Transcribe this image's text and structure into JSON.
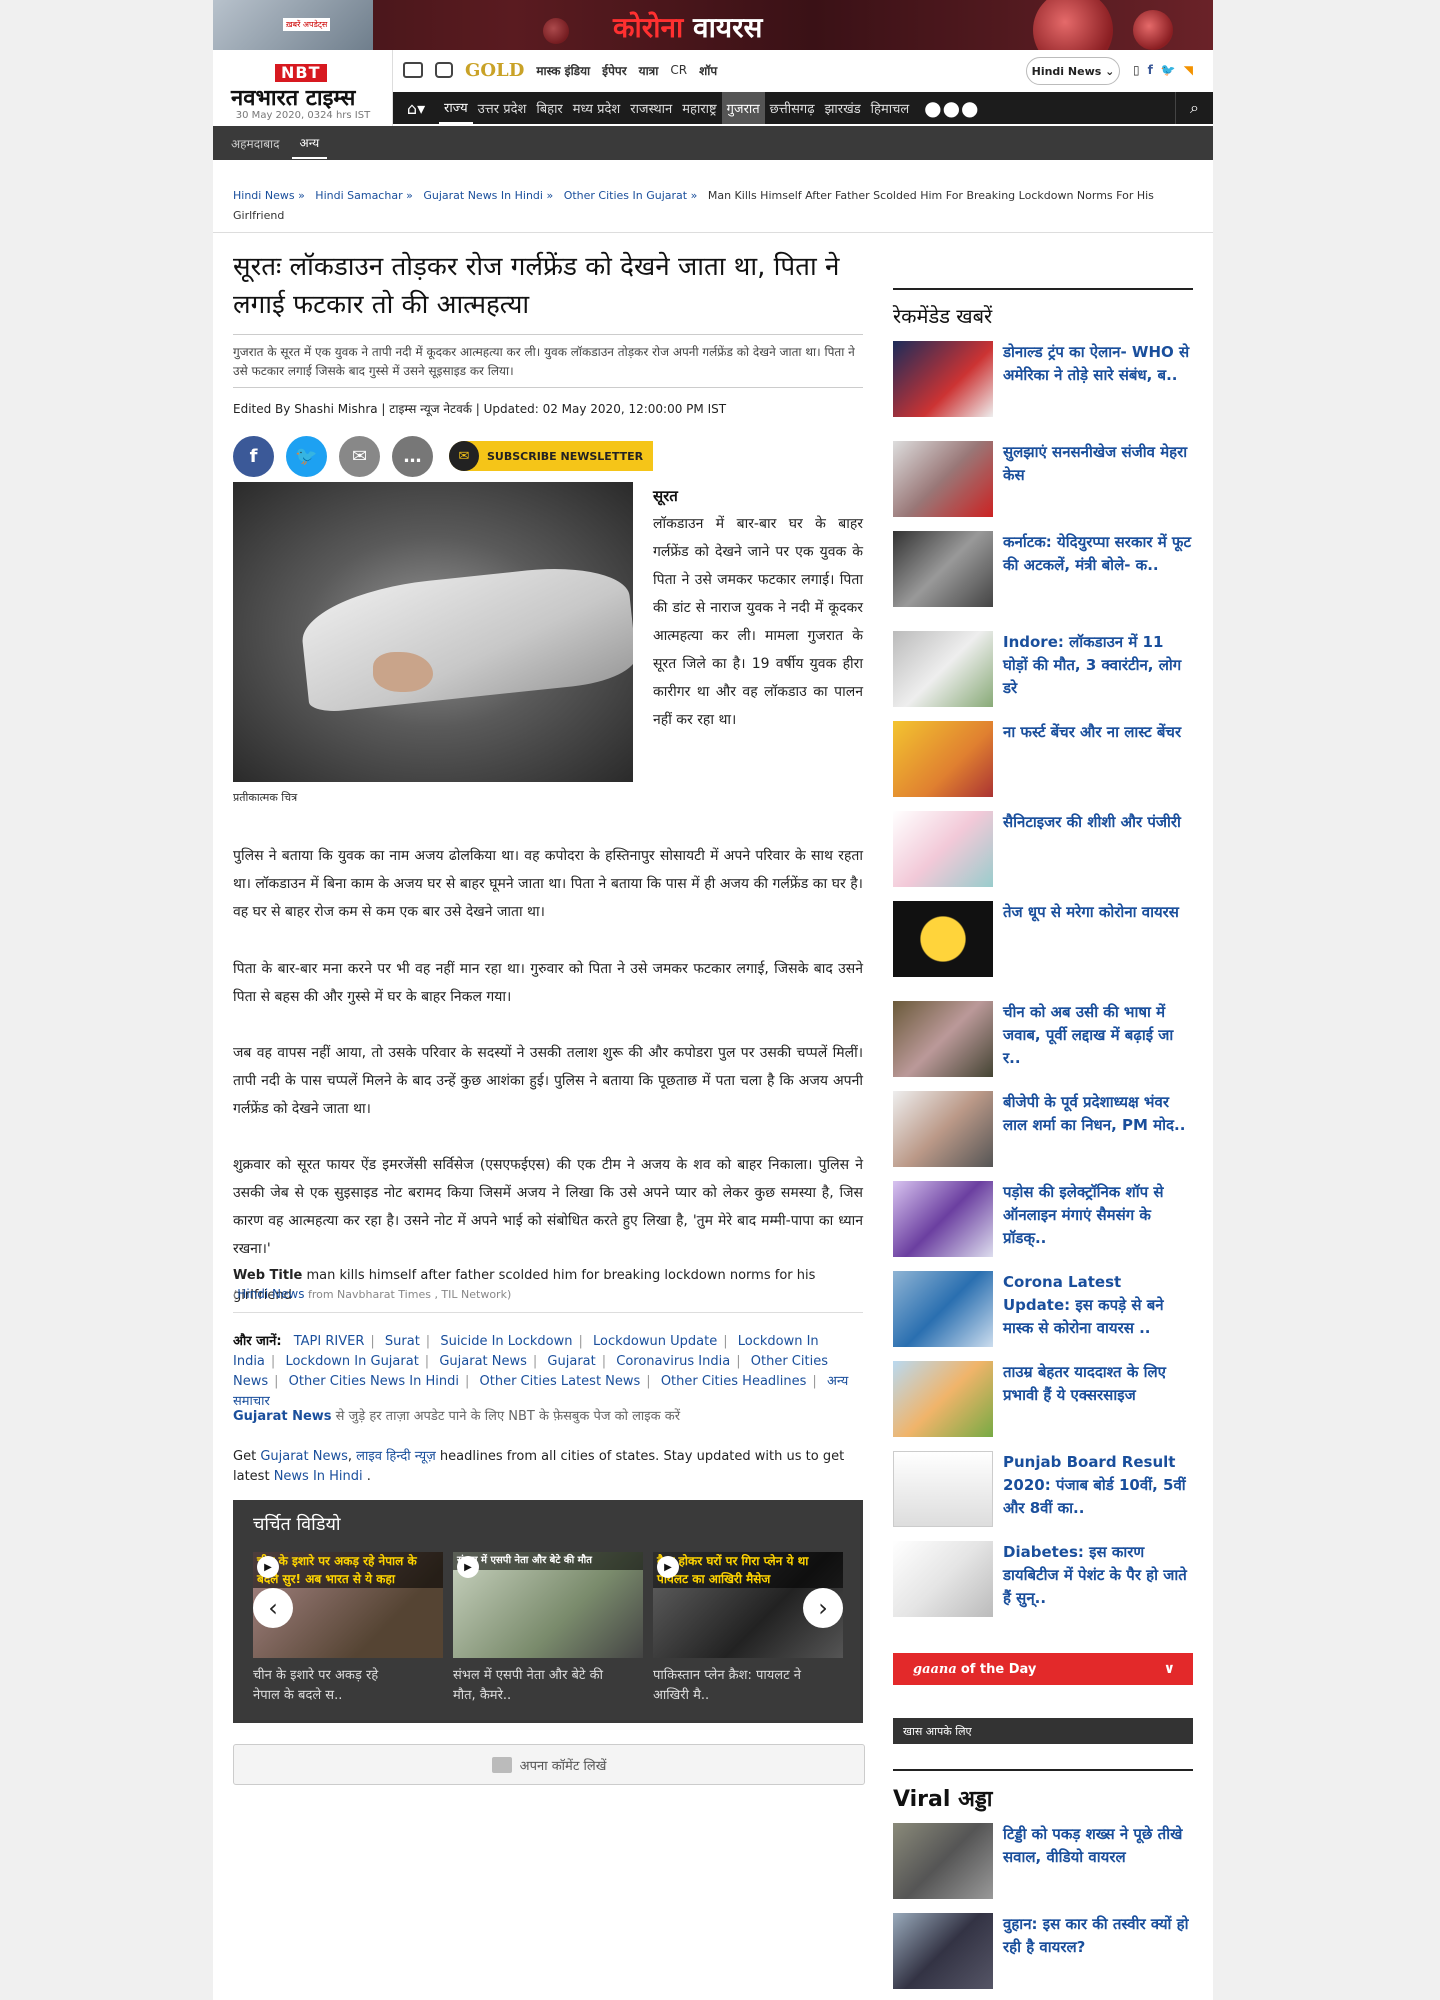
{
  "banner": {
    "title_red": "कोरोना",
    "title_white": "वायरस",
    "thumb_text": "ख़बरें अपडेट्स"
  },
  "logo": {
    "nbt": "NBT",
    "name": "नवभारत टाइम्स",
    "date": "30 May 2020, 0324 hrs IST"
  },
  "util_links": {
    "gold": "GOLD",
    "items": [
      "मास्क इंडिया",
      "ईपेपर",
      "यात्रा",
      "CR",
      "शॉप"
    ]
  },
  "language_select": "Hindi News",
  "social_top": {
    "fb": "f",
    "tw": "t",
    "rss": "rss"
  },
  "nav": {
    "items": [
      "राज्य",
      "उत्तर प्रदेश",
      "बिहार",
      "मध्य प्रदेश",
      "राजस्थान",
      "महाराष्ट्र",
      "गुजरात",
      "छत्तीसगढ़",
      "झारखंड",
      "हिमाचल"
    ],
    "more": "●●●"
  },
  "subnav": {
    "items": [
      "अहमदाबाद",
      "अन्य"
    ]
  },
  "breadcrumb": {
    "items": [
      "Hindi News",
      "Hindi Samachar",
      "Gujarat News In Hindi",
      "Other Cities In Gujarat"
    ],
    "sep": "»",
    "current": "Man Kills Himself After Father Scolded Him For Breaking Lockdown Norms For His Girlfriend"
  },
  "article": {
    "headline": "सूरतः लॉकडाउन तोड़कर रोज गर्लफ्रेंड को देखने जाता था, पिता ने लगाई फटकार तो की आत्महत्या",
    "synopsis": "गुजरात के सूरत में एक युवक ने तापी नदी में कूदकर आत्महत्या कर ली। युवक लॉकडाउन तोड़कर रोज अपनी गर्लफ्रेंड को देखने जाता था। पिता ने उसे फटकार लगाई जिसके बाद गुस्से में उसने सूइसाइड कर लिया।",
    "byline": "Edited By Shashi Mishra | टाइम्स न्यूज नेटवर्क | Updated: 02 May 2020, 12:00:00 PM IST",
    "newsletter": "SUBSCRIBE NEWSLETTER",
    "caption": "प्रतीकात्मक चित्र",
    "place": "सूरत",
    "intro": "लॉकडाउन में बार-बार घर के बाहर गर्लफ्रेंड को देखने जाने पर एक युवक के पिता ने उसे जमकर फटकार लगाई। पिता की डांट से नाराज युवक ने नदी में कूदकर आत्महत्या कर ली। मामला गुजरात के सूरत जिले का है। 19 वर्षीय युवक हीरा कारीगर था और वह लॉकडाउ का पालन नहीं कर रहा था।",
    "p1": "पुलिस ने बताया कि युवक का नाम अजय ढोलकिया था। वह कपोदरा के हस्तिनापुर सोसायटी में अपने परिवार के साथ रहता था। लॉकडाउन में बिना काम के अजय घर से बाहर घूमने जाता था। पिता ने बताया कि पास में ही अजय की गर्लफ्रेंड का घर है। वह घर से बाहर रोज कम से कम एक बार उसे देखने जाता था।",
    "p2": "पिता के बार-बार मना करने पर भी वह नहीं मान रहा था। गुरुवार को पिता ने उसे जमकर फटकार लगाई, जिसके बाद उसने पिता से बहस की और गुस्से में घर के बाहर निकल गया।",
    "p3": "जब वह वापस नहीं आया, तो उसके परिवार के सदस्यों ने उसकी तलाश शुरू की और कपोडरा पुल पर उसकी चप्पलें मिलीं। तापी नदी के पास चप्पलें मिलने के बाद उन्हें कुछ आशंका हुई। पुलिस ने बताया कि पूछताछ में पता चला है कि अजय अपनी गर्लफ्रेंड को देखने जाता था।",
    "p4": "शुक्रवार को सूरत फायर ऐंड इमरजेंसी सर्विसेज (एसएफईएस) की एक टीम ने अजय के शव को बाहर निकाला। पुलिस ने उसकी जेब से एक सुइसाइड नोट बरामद किया जिसमें अजय ने लिखा कि उसे अपने प्यार को लेकर कुछ समस्या है, जिस कारण वह आत्महत्या कर रहा है। उसने नोट में अपने भाई को संबोधित करते हुए लिखा है, 'तुम मेरे बाद मम्मी-पापा का ध्यान रखना।'",
    "webtitle_label": "Web Title",
    "webtitle": "man kills himself after father scolded him for breaking lockdown norms for his girlfriend",
    "src_open": "(",
    "src_link": "Hindi News",
    "src_rest": " from Navbharat Times , TIL Network)"
  },
  "tags": {
    "label": "और जानें:",
    "items": [
      "TAPI RIVER",
      "Surat",
      "Suicide In Lockdown",
      "Lockdowun Update",
      "Lockdown In India",
      "Lockdown In Gujarat",
      "Gujarat News",
      "Gujarat",
      "Coronavirus India",
      "Other Cities News",
      "Other Cities News In Hindi",
      "Other Cities Latest News",
      "Other Cities Headlines",
      "अन्य समाचार"
    ]
  },
  "fb_line": {
    "link": "Gujarat News",
    "text": " से जुड़े हर ताज़ा अपडेट पाने के लिए NBT के फ़ेसबुक पेज को लाइक करें"
  },
  "get_line": {
    "t1": "Get ",
    "l1": "Gujarat News",
    "t2": ", ",
    "l2": "लाइव हिन्दी न्यूज़",
    "t3": " headlines from all cities of states. Stay updated with us to get latest ",
    "l3": "News In Hindi",
    "t4": " ."
  },
  "videos": {
    "title": "चर्चित विडियो",
    "items": [
      {
        "overlay": "चीन के इशारे पर अकड़ रहे नेपाल के बदले सुर! अब भारत से ये कहा",
        "caption": "चीन के इशारे पर अकड़ रहे नेपाल के बदले स.."
      },
      {
        "overlay": "संभल में एसपी नेता और बेटे की मौत",
        "caption": "संभल में एसपी नेता और बेटे की मौत, कैमरे.."
      },
      {
        "overlay": "क्रैश होकर घरों पर गिरा प्लेन ये था पायलट का आखिरी मैसेज",
        "caption": "पाकिस्तान प्लेन क्रैश: पायलट ने आखिरी मै.."
      }
    ],
    "prev": "‹",
    "next": "›"
  },
  "comment_button": "अपना कॉमेंट लिखें",
  "sidebar": {
    "heading": "रेकमेंडेड खबरें",
    "items": [
      "डोनाल्ड ट्रंप का ऐलान- WHO से अमेरिका ने तोड़े सारे संबंध, ब..",
      "सुलझाएं सनसनीखेज संजीव मेहरा केस",
      "कर्नाटक: येदियुरप्पा सरकार में फूट की अटकलें, मंत्री बोले- क..",
      "Indore: लॉकडाउन में 11 घोड़ों की मौत, 3 क्वारंटीन, लोग डरे",
      "ना फर्स्ट बेंचर और ना लास्ट बेंचर",
      "सैनिटाइजर की शीशी और पंजीरी",
      "तेज धूप से मरेगा कोरोना वायरस",
      "चीन को अब उसी की भाषा में जवाब, पूर्वी लद्दाख में बढ़ाई जा र..",
      "बीजेपी के पूर्व प्रदेशाध्यक्ष भंवर लाल शर्मा का निधन, PM मोद..",
      "पड़ोस की इलेक्ट्रॉनिक शॉप से ऑनलाइन मंगाएं सैमसंग के प्रॉडक्..",
      "Corona Latest Update: इस कपड़े से बने मास्क से कोरोना वायरस ..",
      "ताउम्र बेहतर याददाश्त के लिए प्रभावी हैं ये एक्सरसाइज",
      "Punjab Board Result 2020: पंजाब बोर्ड 10वीं, 5वीं और 8वीं का..",
      "Diabetes: इस कारण डायबिटीज में पेशंट के पैर हो जाते हैं सुन्.."
    ],
    "gaana_brand": "gaana",
    "gaana_text": "of the Day",
    "khas": "खास आपके लिए",
    "viral_heading": "Viral अड्डा",
    "viral_items": [
      "टिड्डी को पकड़ शख्स ने पूछे तीखे सवाल, वीडियो वायरल",
      "वुहान: इस कार की तस्वीर क्यों हो रही है वायरल?"
    ]
  }
}
